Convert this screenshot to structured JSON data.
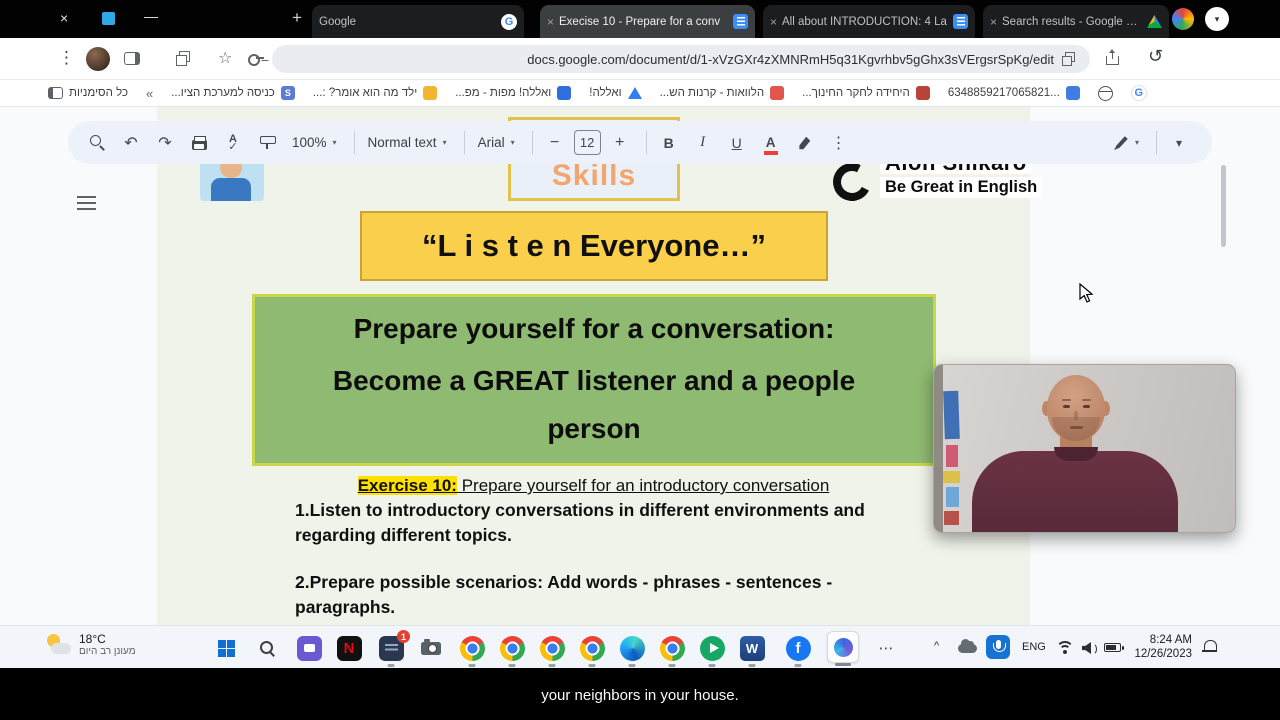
{
  "window": {
    "close": "×",
    "minimize": "—",
    "new_tab": "+",
    "tab_chevron": "▾"
  },
  "tabs": [
    {
      "title": "Google"
    },
    {
      "title": "Execise 10 - Prepare for a conv",
      "close": "×"
    },
    {
      "title": "All about INTRODUCTION: 4 La",
      "close": "×"
    },
    {
      "title": "Search results - Google Drive",
      "close": "×"
    }
  ],
  "toolbar": {
    "menu": "⋮",
    "star": "☆",
    "reload": "↺",
    "url": "docs.google.com/document/d/1-xVzGXr4zXMNRmH5q31Kgvrhbv5gGhx3sVErgsrSpKg/edit"
  },
  "bookmarks": {
    "all": "כל הסימניות",
    "overflow": "«",
    "items": [
      {
        "label": "כניסה למערכת הציו...",
        "fav": "S"
      },
      {
        "label": "ילד מה הוא אומר? :..."
      },
      {
        "label": "ואללה! מפות - מפ..."
      },
      {
        "label": "ואללה!"
      },
      {
        "label": "הלוואות - קרנות הש..."
      },
      {
        "label": "היחידה לחקר החינוך..."
      },
      {
        "label": "6348859217065821..."
      }
    ]
  },
  "docs_toolbar": {
    "undo": "↶",
    "redo": "↷",
    "spell": "A",
    "check": "✓",
    "zoom": "100%",
    "style": "Normal text",
    "font": "Arial",
    "minus": "−",
    "size": "12",
    "plus": "+",
    "bold": "B",
    "italic": "I",
    "underline": "U",
    "color": "A",
    "more": "⋮",
    "chevron": "▾",
    "collapse": "▾"
  },
  "doc": {
    "skills": "Skills",
    "brand1": "Alon Shikaro",
    "brand2": "Be Great in English",
    "listen": "“L i s t e n Everyone…”",
    "green1": "Prepare yourself for a conversation:",
    "green2": "Become a GREAT listener and a people person",
    "ex_label": "Exercise 10:",
    "ex_text": " Prepare yourself for an introductory conversation",
    "p1": "1.Listen to introductory conversations in different environments and regarding different topics.",
    "p2": "2.Prepare possible scenarios: Add words - phrases - sentences - paragraphs."
  },
  "taskbar": {
    "temp": "18°C",
    "desc": "מעונן רב היום",
    "badge": "1",
    "netflix": "N",
    "word": "W",
    "facebook": "f",
    "more": "⋯",
    "tray_chevron": "^",
    "lang": "ENG",
    "time": "8:24 AM",
    "date": "12/26/2023"
  },
  "caption": "your neighbors in your house."
}
